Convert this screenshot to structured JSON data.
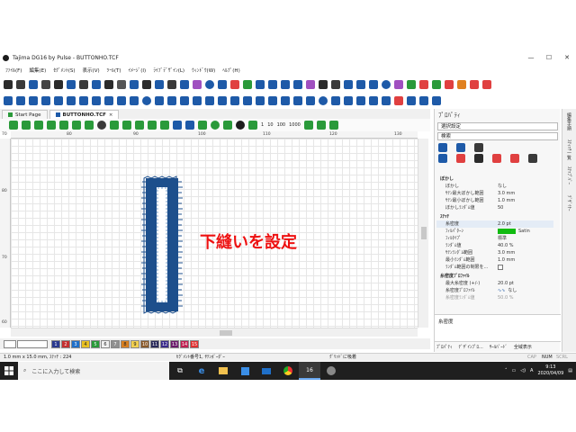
{
  "window": {
    "title": "Tajima DG16 by Pulse - BUTTONHO.TCF",
    "controls": [
      "—",
      "☐",
      "✕"
    ]
  },
  "menu": [
    "ﾌｧｲﾙ(F)",
    "編集(E)",
    "ｾｸﾞﾒﾝﾄ(S)",
    "表示(V)",
    "ﾂｰﾙ(T)",
    "ｲﾒｰｼﾞ(I)",
    "ﾗｲﾌﾞﾃﾞｻﾞｲﾝ(L)",
    "ｳｨﾝﾄﾞｳ(W)",
    "ﾍﾙﾌﾟ(H)"
  ],
  "doc_tabs": [
    {
      "label": "Start Page",
      "active": false
    },
    {
      "label": "BUTTONHO.TCF",
      "active": true
    }
  ],
  "draw_toolbar": {
    "zoom_buttons": [
      "1",
      "10",
      "100",
      "1000"
    ]
  },
  "rulers": {
    "top_ticks": [
      "70",
      "80",
      "90",
      "100",
      "110",
      "120",
      "130"
    ],
    "left_ticks": [
      "80",
      "70",
      "60"
    ]
  },
  "annotation": "下縫いを設定",
  "colors": {
    "accent": "#1e5aa8",
    "stitch": "#1d4f8c",
    "annotation": "#ee1111",
    "fill_swatch": "#11bb11"
  },
  "color_strip": [
    {
      "n": "1",
      "c": "#2b3a8f"
    },
    {
      "n": "2",
      "c": "#c43030"
    },
    {
      "n": "3",
      "c": "#1f6fc8"
    },
    {
      "n": "4",
      "c": "#e8c020"
    },
    {
      "n": "5",
      "c": "#2a9a3a"
    },
    {
      "n": "6",
      "c": "#f0f0f0"
    },
    {
      "n": "7",
      "c": "#909090"
    },
    {
      "n": "8",
      "c": "#d88020"
    },
    {
      "n": "9",
      "c": "#f2d050"
    },
    {
      "n": "10",
      "c": "#8a5a2a"
    },
    {
      "n": "11",
      "c": "#2a2a5a"
    },
    {
      "n": "12",
      "c": "#3a2a8a"
    },
    {
      "n": "13",
      "c": "#6a1a6a"
    },
    {
      "n": "14",
      "c": "#c02050"
    },
    {
      "n": "15",
      "c": "#e03030"
    }
  ],
  "properties": {
    "title": "ﾌﾟﾛﾊﾟﾃｨ",
    "selector": "選択設定",
    "search_placeholder": "検索",
    "rows": [
      {
        "type": "sec",
        "k": "ぼかし"
      },
      {
        "k": "ぼかし",
        "v": "なし"
      },
      {
        "k": "ｻﾃﾝ最大ぼかし範囲",
        "v": "3.0 mm"
      },
      {
        "k": "ｻﾃﾝ最小ぼかし範囲",
        "v": "1.0 mm"
      },
      {
        "k": "ぼかしﾗﾝﾀﾞﾑ値",
        "v": "50"
      },
      {
        "type": "sec",
        "k": "ｽﾃｯﾁ"
      },
      {
        "k": "糸密度",
        "v": "2.0 pt",
        "hl": true
      },
      {
        "k": "ﾌｨﾙﾊﾟﾀｰﾝ",
        "v": "Satin",
        "swatch": true
      },
      {
        "k": "ﾌｨﾙﾀｲﾌﾟ",
        "v": "標準"
      },
      {
        "k": "ﾗﾝﾀﾞﾑ値",
        "v": "40.0 %"
      },
      {
        "k": "ｻﾃﾝﾗﾝﾀﾞﾑ範囲",
        "v": "3.0 mm"
      },
      {
        "k": "最小ﾗﾝﾀﾞﾑ範囲",
        "v": "1.0 mm"
      },
      {
        "k": "ﾗﾝﾀﾞﾑ範囲の制限を...",
        "v": ""
      },
      {
        "type": "sec",
        "k": "糸密度ﾌﾟﾛﾌｧｲﾙ"
      },
      {
        "k": "最大糸密度 (+/-)",
        "v": "20.0 pt"
      },
      {
        "k": "糸密度ﾌﾟﾛﾌｧｲﾙ",
        "v": "なし",
        "wave": true
      },
      {
        "k": "糸密度ﾗﾝﾀﾞﾑ値",
        "v": "50.0 %",
        "dim": true
      }
    ],
    "description_title": "糸密度",
    "bottom_tabs": [
      "ﾌﾟﾛﾊﾟﾃｨ",
      "ﾃﾞｻﾞｲﾝﾌﾟﾛ...",
      "ｻｰﾙﾊﾞｰﾄﾞ",
      "全域表示"
    ]
  },
  "side_tabs": [
    "編集手順",
    "ｽﾃｨｯﾁ一覧",
    "ｽﾃｯﾌﾟﾊﾞｰ",
    "ﾃﾞｻﾞｲﾅｰ"
  ],
  "status": {
    "left": "1.0 mm x 15.0 mm, ｽﾃｯﾁ : 224",
    "middle": "ｾｸﾞﾒﾝﾄ番号1, ｻﾃﾝﾎﾞｰﾀﾞｰ",
    "right": "ｸﾞﾘｯﾄﾞに吸着",
    "caps": "CAP",
    "num": "NUM",
    "scrl": "SCRL"
  },
  "taskbar": {
    "search_placeholder": "ここに入力して検索",
    "time": "9:13",
    "date": "2020/04/09",
    "ime": "A"
  }
}
